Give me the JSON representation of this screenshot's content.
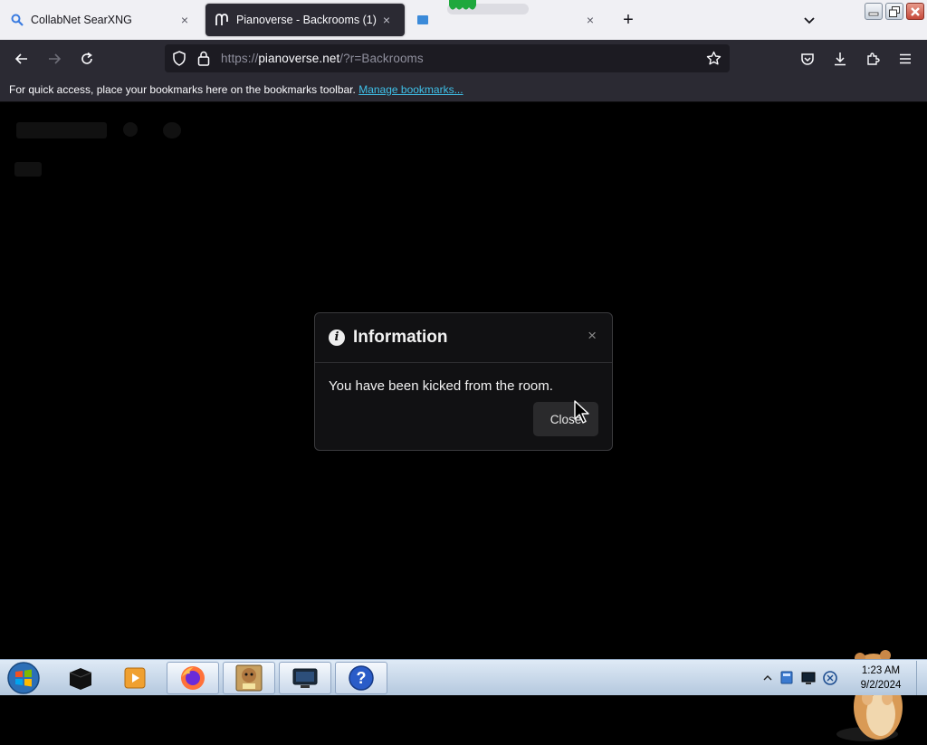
{
  "tabs": [
    {
      "title": "CollabNet SearXNG",
      "close": "×"
    },
    {
      "title": "Pianoverse - Backrooms (1)",
      "close": "×"
    },
    {
      "close": "×"
    }
  ],
  "tabstrip": {
    "new_tab": "+"
  },
  "navbar": {
    "url_prefix": "https://",
    "url_host": "pianoverse.net",
    "url_rest": "/?r=Backrooms"
  },
  "bookmarks": {
    "message": "For quick access, place your bookmarks here on the bookmarks toolbar.",
    "manage_link": "Manage bookmarks..."
  },
  "modal": {
    "icon": "i",
    "title": "Information",
    "close_x": "×",
    "message": "You have been kicked from the room.",
    "close_button": "Close"
  },
  "taskbar": {
    "time": "1:23 AM",
    "date": "9/2/2024",
    "items": [
      "terminal-app",
      "media-player",
      "firefox",
      "hamster-box-game",
      "remote-desktop",
      "help"
    ]
  },
  "colors": {
    "chrome_dark": "#2b2a33",
    "urlbar": "#1c1b22",
    "tabstrip": "#f0f0f4",
    "link": "#3fc0e8",
    "modal_bg": "#111113"
  }
}
